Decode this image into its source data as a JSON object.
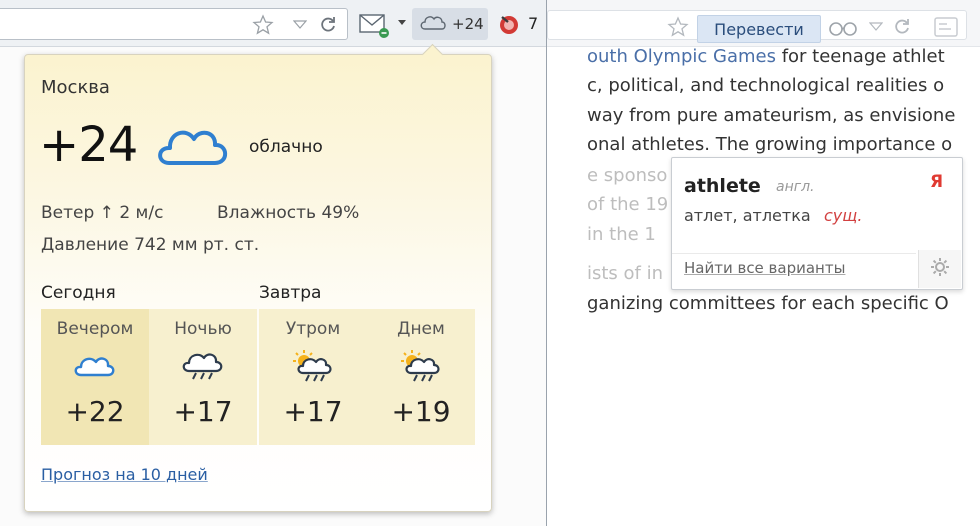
{
  "left_toolbar": {
    "weather_temp": "+24",
    "yandex_count": "7",
    "icons": [
      "star-icon",
      "dropdown-arrow-icon",
      "reload-icon",
      "mail-icon",
      "cloud-icon",
      "yandex-bar-icon"
    ]
  },
  "weather": {
    "city": "Москва",
    "current_temp": "+24",
    "condition": "облачно",
    "wind": "Ветер  ↑ 2 м/с",
    "humidity": "Влажность  49%",
    "pressure": "Давление  742 мм рт. ст.",
    "today_title": "Сегодня",
    "tomorrow_title": "Завтра",
    "forecast": [
      {
        "label": "Вечером",
        "temp": "+22",
        "icon": "cloud-icon"
      },
      {
        "label": "Ночью",
        "temp": "+17",
        "icon": "cloud-rain-icon"
      },
      {
        "label": "Утром",
        "temp": "+17",
        "icon": "sun-cloud-rain-icon"
      },
      {
        "label": "Днем",
        "temp": "+19",
        "icon": "sun-cloud-rain-icon"
      }
    ],
    "forecast_link": "Прогноз на 10 дней"
  },
  "right_toolbar": {
    "translate_label": "Перевести",
    "icons": [
      "star-icon",
      "glasses-icon",
      "dropdown-arrow-icon",
      "reload-icon",
      "app-icon"
    ]
  },
  "article": {
    "lines": [
      {
        "pre": "",
        "blue": "outh Olympic Games",
        "post": " for teenage athlet"
      },
      {
        "pre": "c, political, and technological realities o",
        "blue": "",
        "post": ""
      },
      {
        "pre": "way from pure amateurism, as envisione",
        "blue": "",
        "post": ""
      },
      {
        "pre": "onal athletes. The growing importance o",
        "blue": "",
        "post": ""
      },
      {
        "pre": "e sponso",
        "blue": "",
        "post": ""
      },
      {
        "pre": "of the 19",
        "blue": "",
        "post": ""
      },
      {
        "pre": "in the 1",
        "blue": "",
        "post": ""
      },
      {
        "pre": "ists of in",
        "blue": "",
        "post": ""
      },
      {
        "pre": "ganizing committees for each specific O",
        "blue": "",
        "post": ""
      }
    ]
  },
  "translation": {
    "word": "athlete",
    "lang": "англ.",
    "brand": "Я",
    "meaning": "атлет, атлетка",
    "part_of_speech": "сущ.",
    "link": "Найти все варианты"
  },
  "colors": {
    "popup_bg": "#fbf3cf",
    "forecast_highlight": "#f1e6b4",
    "link": "#2a5ea3",
    "yandex_red": "#e03a32",
    "cloud_blue": "#2f7fd0"
  }
}
